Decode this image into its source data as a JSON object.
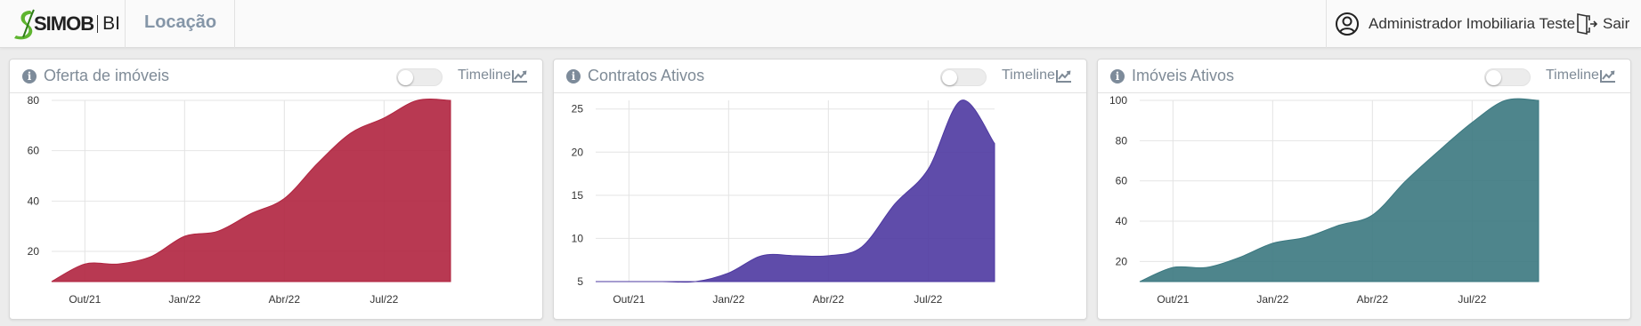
{
  "header": {
    "logo_text": "SIMOB",
    "logo_suffix": "BI",
    "section_title": "Locação",
    "user_name": "Administrador Imobiliaria Teste",
    "logout_label": "Sair",
    "brand_color": "#5fb530"
  },
  "cards": [
    {
      "info_icon": "i",
      "title": "Oferta de imóveis",
      "timeline_label": "Timeline",
      "timeline_icon": "line-chart-icon",
      "toggle_on": false,
      "color": "#b0243f"
    },
    {
      "info_icon": "i",
      "title": "Contratos Ativos",
      "timeline_label": "Timeline",
      "timeline_icon": "line-chart-icon",
      "toggle_on": false,
      "color": "#4e39a1"
    },
    {
      "info_icon": "i",
      "title": "Imóveis Ativos",
      "timeline_label": "Timeline",
      "timeline_icon": "line-chart-icon",
      "toggle_on": false,
      "color": "#3b7880"
    }
  ],
  "chart_data": [
    {
      "type": "area",
      "color": "#b0243f",
      "x_ticks": [
        "Out/21",
        "Jan/22",
        "Abr/22",
        "Jul/22"
      ],
      "x_tick_index": [
        1,
        4,
        7,
        10
      ],
      "y_ticks": [
        20,
        40,
        60,
        80
      ],
      "ylim": [
        8,
        80
      ],
      "grid": true,
      "values": [
        8,
        15,
        15,
        18,
        26,
        28,
        35,
        41,
        55,
        67,
        73,
        80,
        80
      ]
    },
    {
      "type": "area",
      "color": "#4e39a1",
      "x_ticks": [
        "Out/21",
        "Jan/22",
        "Abr/22",
        "Jul/22"
      ],
      "x_tick_index": [
        1,
        4,
        7,
        10
      ],
      "y_ticks": [
        5,
        10,
        15,
        20,
        25
      ],
      "ylim": [
        5,
        26
      ],
      "grid": true,
      "values": [
        5,
        5,
        5,
        5,
        6,
        8,
        8,
        8,
        9,
        14,
        18,
        26,
        21
      ]
    },
    {
      "type": "area",
      "color": "#3b7880",
      "x_ticks": [
        "Out/21",
        "Jan/22",
        "Abr/22",
        "Jul/22"
      ],
      "x_tick_index": [
        1,
        4,
        7,
        10
      ],
      "y_ticks": [
        20,
        40,
        60,
        80,
        100
      ],
      "ylim": [
        10,
        100
      ],
      "grid": true,
      "values": [
        10,
        17,
        17,
        22,
        29,
        32,
        38,
        43,
        60,
        75,
        89,
        100,
        100
      ]
    }
  ]
}
